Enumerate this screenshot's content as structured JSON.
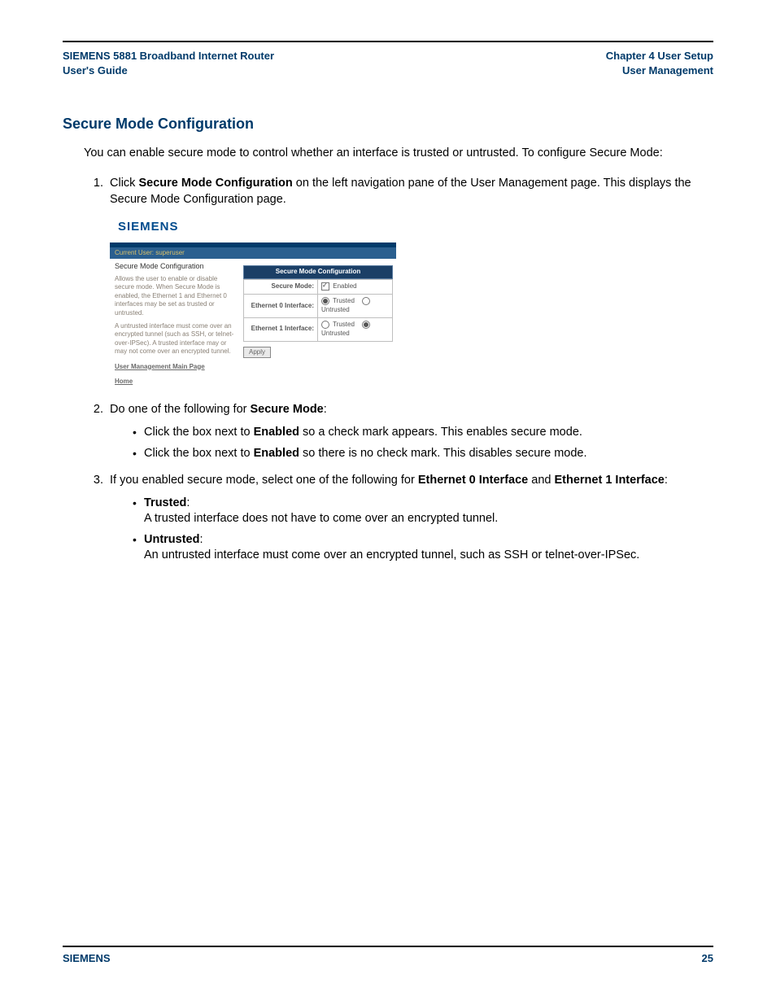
{
  "header": {
    "left_line1": "SIEMENS 5881 Broadband Internet Router",
    "left_line2": "User's Guide",
    "right_line1": "Chapter 4  User Setup",
    "right_line2": "User Management"
  },
  "section_title": "Secure Mode Configuration",
  "intro": "You can enable secure mode to control whether an interface is trusted or untrusted. To configure Secure Mode:",
  "step1": {
    "pre": "Click ",
    "bold": "Secure Mode Configuration",
    "post": " on the left navigation pane of the User Management page. This displays the Secure Mode Configuration page."
  },
  "screenshot": {
    "brand": "SIEMENS",
    "userbar": "Current User: superuser",
    "side_title": "Secure Mode Configuration",
    "side_p1": "Allows the user to enable or disable secure mode. When Secure Mode is enabled, the Ethernet 1 and Ethernet 0 interfaces may be set as trusted or untrusted.",
    "side_p2": "A untrusted interface must come over an encrypted tunnel (such as SSH, or telnet-over-IPSec). A trusted interface may or may not come over an encrypted tunnel.",
    "side_link1": "User Management Main Page",
    "side_link2": "Home",
    "panel_title": "Secure Mode Configuration",
    "row_secure_label": "Secure Mode:",
    "row_secure_opt": "Enabled",
    "row_eth0_label": "Ethernet 0 Interface:",
    "row_eth1_label": "Ethernet 1 Interface:",
    "opt_trusted": "Trusted",
    "opt_untrusted": "Untrusted",
    "apply": "Apply"
  },
  "step2": {
    "pre": "Do one of the following for ",
    "bold": "Secure Mode",
    "post": ":",
    "b1_pre": "Click the box next to ",
    "b1_bold": "Enabled",
    "b1_post": " so a check mark appears. This enables secure mode.",
    "b2_pre": "Click the box next to ",
    "b2_bold": "Enabled",
    "b2_post": " so there is no check mark. This disables secure mode."
  },
  "step3": {
    "pre": "If you enabled secure mode, select one of the following for ",
    "bold1": "Ethernet 0 Interface",
    "mid": " and ",
    "bold2": "Ethernet 1 Interface",
    "post": ":",
    "t_label": "Trusted",
    "t_desc": "A trusted interface does not have to come over an encrypted tunnel.",
    "u_label": "Untrusted",
    "u_desc": "An untrusted interface must come over an encrypted tunnel, such as SSH or telnet-over-IPSec."
  },
  "footer": {
    "left": "SIEMENS",
    "right": "25"
  }
}
